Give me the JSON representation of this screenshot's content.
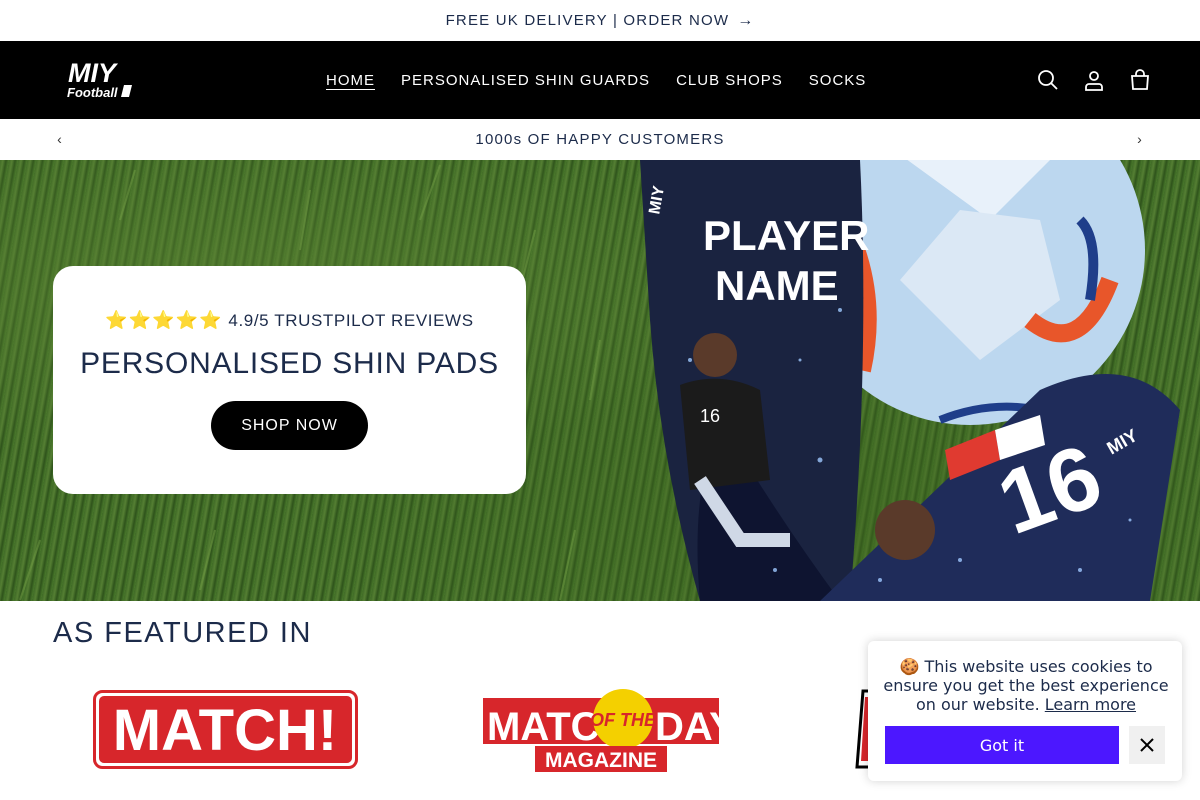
{
  "announcement": {
    "text": "FREE UK DELIVERY | ORDER NOW",
    "arrow": "→"
  },
  "header": {
    "logo_text_top": "MIY",
    "logo_text_bottom": "Football",
    "nav": [
      {
        "label": "HOME"
      },
      {
        "label": "PERSONALISED SHIN GUARDS"
      },
      {
        "label": "CLUB SHOPS"
      },
      {
        "label": "SOCKS"
      }
    ],
    "icons": [
      "search-icon",
      "account-icon",
      "cart-icon"
    ]
  },
  "slider": {
    "text": "1000s OF HAPPY CUSTOMERS",
    "prev": "‹",
    "next": "›"
  },
  "hero": {
    "stars": "⭐⭐⭐⭐⭐",
    "rating_text": "4.9/5 TRUSTPILOT REVIEWS",
    "title": "PERSONALISED SHIN PADS",
    "button": "SHOP NOW",
    "shin_text_1": "PLAYER",
    "shin_text_2": "NAME",
    "shin_number": "16",
    "shin_brand": "MIY"
  },
  "featured": {
    "heading": "AS FEATURED IN",
    "logo_match": "MATCH!",
    "logo_motd_top": "MATCH",
    "logo_motd_of": "OF THE",
    "logo_motd_day": "DAY",
    "logo_motd_sub": "MAGAZINE"
  },
  "cookie": {
    "emoji": "🍪",
    "message": "This website uses cookies to ensure you get the best experience on our website.",
    "learn_more": "Learn more",
    "button": "Got it",
    "close": "✕"
  },
  "colors": {
    "brand_navy": "#1c2b4a",
    "header_bg": "#000000",
    "cookie_button": "#4c17ff",
    "match_red": "#d7262b",
    "stars": "#f5b301"
  }
}
